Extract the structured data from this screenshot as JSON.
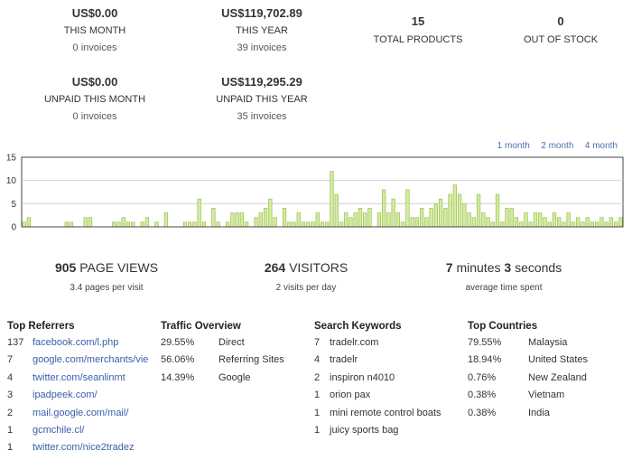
{
  "stats_top": [
    {
      "value": "US$0.00",
      "label": "THIS MONTH",
      "sub": "0 invoices"
    },
    {
      "value": "US$119,702.89",
      "label": "THIS YEAR",
      "sub": "39 invoices"
    },
    {
      "value": "15",
      "label": "TOTAL PRODUCTS",
      "sub": ""
    },
    {
      "value": "0",
      "label": "OUT OF STOCK",
      "sub": ""
    }
  ],
  "stats_bottom": [
    {
      "value": "US$0.00",
      "label": "UNPAID THIS MONTH",
      "sub": "0 invoices"
    },
    {
      "value": "US$119,295.29",
      "label": "UNPAID THIS YEAR",
      "sub": "35 invoices"
    }
  ],
  "range_links": [
    "1 month",
    "2 month",
    "4 month"
  ],
  "chart_data": {
    "type": "bar",
    "ylim": [
      0,
      15
    ],
    "yticks": [
      "15",
      "10",
      "5",
      "0"
    ],
    "values": [
      1,
      2,
      0,
      0,
      0,
      0,
      0,
      0,
      0,
      1,
      1,
      0,
      0,
      2,
      2,
      0,
      0,
      0,
      0,
      1,
      1,
      2,
      1,
      1,
      0,
      1,
      2,
      0,
      1,
      0,
      3,
      0,
      0,
      0,
      1,
      1,
      1,
      6,
      1,
      0,
      4,
      1,
      0,
      1,
      3,
      3,
      3,
      1,
      0,
      2,
      3,
      4,
      6,
      2,
      0,
      4,
      1,
      1,
      3,
      1,
      1,
      1,
      3,
      1,
      1,
      12,
      7,
      1,
      3,
      2,
      3,
      4,
      3,
      4,
      0,
      3,
      8,
      3,
      6,
      3,
      1,
      8,
      2,
      2,
      4,
      2,
      4,
      5,
      6,
      4,
      7,
      9,
      7,
      5,
      3,
      2,
      7,
      3,
      2,
      1,
      7,
      1,
      4,
      4,
      2,
      1,
      3,
      1,
      3,
      3,
      2,
      1,
      3,
      2,
      1,
      3,
      1,
      2,
      1,
      2,
      1,
      1,
      2,
      1,
      2,
      1,
      2
    ]
  },
  "summary": [
    {
      "num": "905",
      "label": "PAGE VIEWS",
      "sub": "3.4 pages per visit"
    },
    {
      "num": "264",
      "label": "VISITORS",
      "sub": "2 visits per day"
    },
    {
      "num1": "7",
      "text1": "minutes",
      "num2": "3",
      "text2": "seconds",
      "sub": "average time spent"
    }
  ],
  "referrers": {
    "title": "Top Referrers",
    "rows": [
      {
        "count": "137",
        "link": "facebook.com/l.php"
      },
      {
        "count": "7",
        "link": "google.com/merchants/vie"
      },
      {
        "count": "4",
        "link": "twitter.com/seanlinmt"
      },
      {
        "count": "3",
        "link": "ipadpeek.com/"
      },
      {
        "count": "2",
        "link": "mail.google.com/mail/"
      },
      {
        "count": "1",
        "link": "gcmchile.cl/"
      },
      {
        "count": "1",
        "link": "twitter.com/nice2tradez"
      }
    ]
  },
  "traffic": {
    "title": "Traffic Overview",
    "rows": [
      {
        "pct": "29.55%",
        "label": "Direct"
      },
      {
        "pct": "56.06%",
        "label": "Referring Sites"
      },
      {
        "pct": "14.39%",
        "label": "Google"
      }
    ]
  },
  "keywords": {
    "title": "Search Keywords",
    "rows": [
      {
        "count": "7",
        "kw": "tradelr.com"
      },
      {
        "count": "4",
        "kw": "tradelr"
      },
      {
        "count": "2",
        "kw": "inspiron n4010"
      },
      {
        "count": "1",
        "kw": "orion pax"
      },
      {
        "count": "1",
        "kw": "mini remote control boats"
      },
      {
        "count": "1",
        "kw": "juicy sports bag"
      }
    ]
  },
  "countries": {
    "title": "Top Countries",
    "rows": [
      {
        "pct": "79.55%",
        "country": "Malaysia"
      },
      {
        "pct": "18.94%",
        "country": "United States"
      },
      {
        "pct": "0.76%",
        "country": "New Zealand"
      },
      {
        "pct": "0.38%",
        "country": "Vietnam"
      },
      {
        "pct": "0.38%",
        "country": "India"
      }
    ]
  }
}
